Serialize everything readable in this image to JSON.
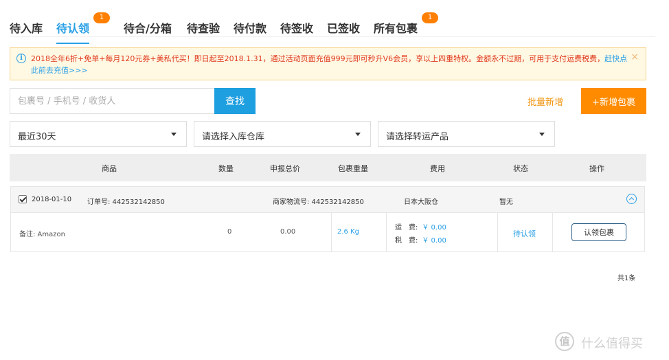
{
  "tabs": [
    {
      "label": "待入库",
      "badge": null
    },
    {
      "label": "待认领",
      "badge": "1",
      "active": true
    },
    {
      "label": "待合/分箱",
      "badge": null
    },
    {
      "label": "待查验",
      "badge": null
    },
    {
      "label": "待付款",
      "badge": null
    },
    {
      "label": "待签收",
      "badge": null
    },
    {
      "label": "已签收",
      "badge": null
    },
    {
      "label": "所有包裹",
      "badge": "1"
    }
  ],
  "notice": {
    "text": "2018全年6折+免单+每月120元券+美私代买！即日起至2018.1.31，通过活动页面充值999元即可秒升V6会员，享以上四重特权。金额永不过期，可用于支付运费税费，",
    "link": "赶快点此前去充值>>>",
    "close": "×",
    "info_icon": "i"
  },
  "search": {
    "placeholder": "包裹号 / 手机号 / 收货人",
    "button": "查找"
  },
  "actions": {
    "batch_add": "批量新增",
    "add_package": "+新增包裹"
  },
  "filters": {
    "date": "最近30天",
    "warehouse": "请选择入库仓库",
    "product": "请选择转运产品"
  },
  "table": {
    "headers": [
      "商品",
      "数量",
      "申报总价",
      "包裹重量",
      "费用",
      "状态",
      "操作"
    ]
  },
  "order": {
    "checked": true,
    "date": "2018-01-10",
    "order_no": "订单号: 442532142850",
    "merchant_tracking": "商家物流号: 442532142850",
    "warehouse": "日本大阪仓",
    "extra": "暂无",
    "note": "备注: Amazon",
    "quantity": "0",
    "declared_total": "0.00",
    "weight": "2.6 Kg",
    "shipping_label": "运　费:",
    "shipping_value": "￥ 0.00",
    "tax_label": "税　费:",
    "tax_value": "￥ 0.00",
    "status": "待认领",
    "action": "认领包裹"
  },
  "pagination": {
    "total": "共1条"
  },
  "watermark": {
    "icon": "值",
    "text": "什么值得买"
  }
}
